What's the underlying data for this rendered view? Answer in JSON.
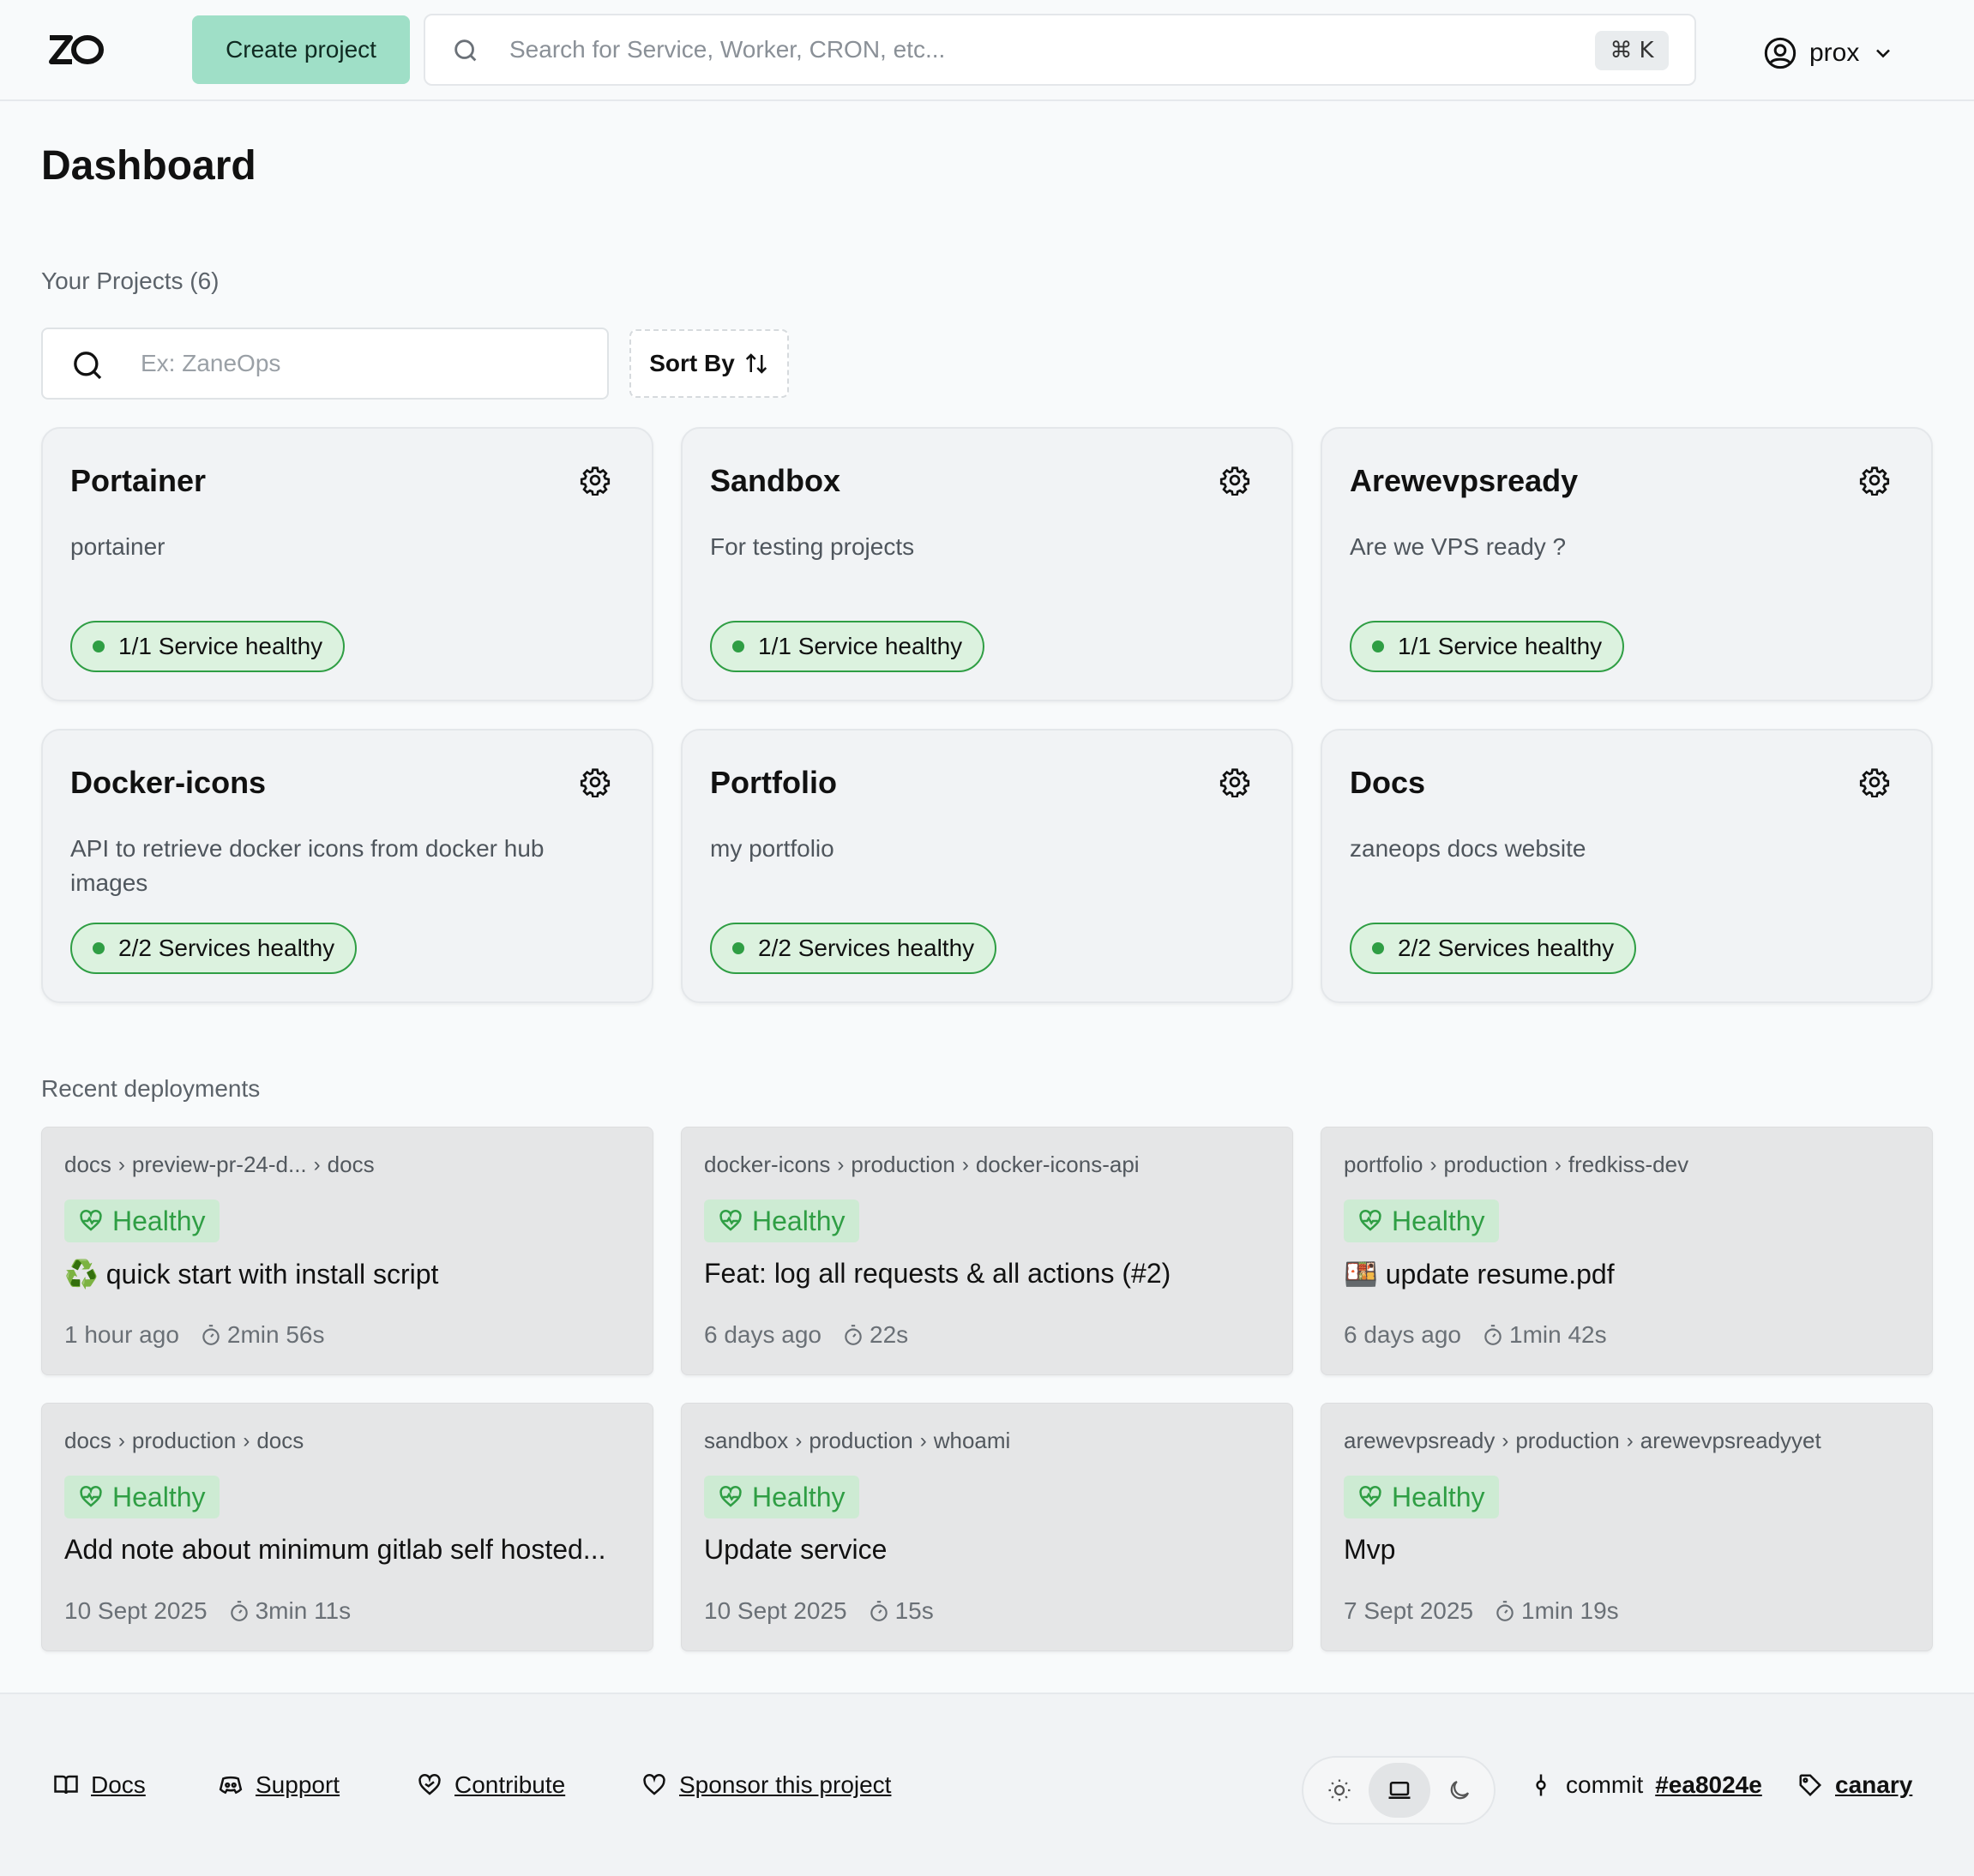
{
  "header": {
    "logo_text": "ZO",
    "create_label": "Create project",
    "search_placeholder": "Search for Service, Worker, CRON, etc...",
    "shortcut_symbol": "⌘",
    "shortcut_key": "K",
    "username": "prox"
  },
  "main": {
    "title": "Dashboard",
    "projects_label": "Your Projects (6)",
    "project_search_placeholder": "Ex: ZaneOps",
    "sort_label": "Sort By",
    "projects": [
      {
        "name": "Portainer",
        "description": "portainer",
        "badge": "1/1 Service healthy"
      },
      {
        "name": "Sandbox",
        "description": "For testing projects",
        "badge": "1/1 Service healthy"
      },
      {
        "name": "Arewevpsready",
        "description": "Are we VPS ready ?",
        "badge": "1/1 Service healthy"
      },
      {
        "name": "Docker-icons",
        "description": "API to retrieve docker icons from docker hub images",
        "badge": "2/2 Services healthy"
      },
      {
        "name": "Portfolio",
        "description": "my portfolio",
        "badge": "2/2 Services healthy"
      },
      {
        "name": "Docs",
        "description": "zaneops docs website",
        "badge": "2/2 Services healthy"
      }
    ],
    "deployments_label": "Recent deployments",
    "deployments": [
      {
        "project": "docs",
        "env": "preview-pr-24-d...",
        "service": "docs",
        "status": "Healthy",
        "message": "♻️ quick start with install script",
        "time": "1 hour ago",
        "duration": "2min 56s"
      },
      {
        "project": "docker-icons",
        "env": "production",
        "service": "docker-icons-api",
        "status": "Healthy",
        "message": "Feat: log all requests & all actions (#2)",
        "time": "6 days ago",
        "duration": "22s"
      },
      {
        "project": "portfolio",
        "env": "production",
        "service": "fredkiss-dev",
        "status": "Healthy",
        "message": "🍱 update resume.pdf",
        "time": "6 days ago",
        "duration": "1min 42s"
      },
      {
        "project": "docs",
        "env": "production",
        "service": "docs",
        "status": "Healthy",
        "message": "Add note about minimum gitlab self hosted...",
        "time": "10 Sept 2025",
        "duration": "3min 11s"
      },
      {
        "project": "sandbox",
        "env": "production",
        "service": "whoami",
        "status": "Healthy",
        "message": "Update service",
        "time": "10 Sept 2025",
        "duration": "15s"
      },
      {
        "project": "arewevpsready",
        "env": "production",
        "service": "arewevpsreadyyet",
        "status": "Healthy",
        "message": "Mvp",
        "time": "7 Sept 2025",
        "duration": "1min 19s"
      }
    ]
  },
  "footer": {
    "docs": "Docs",
    "support": "Support",
    "contribute": "Contribute",
    "sponsor": "Sponsor this project",
    "commit_label": "commit",
    "commit_hash": "#ea8024e",
    "channel": "canary",
    "theme_selected": "system"
  },
  "colors": {
    "accent": "#9fdfc7",
    "healthy": "#2f9e44",
    "healthy_bg": "#dcf2df"
  },
  "icons": [
    "search-icon",
    "user-circle-icon",
    "chevron-down-icon",
    "gear-icon",
    "heart-pulse-icon",
    "timer-icon",
    "book-icon",
    "discord-icon",
    "hand-heart-icon",
    "heart-icon",
    "sun-icon",
    "laptop-icon",
    "moon-icon",
    "git-commit-icon",
    "tag-icon"
  ]
}
